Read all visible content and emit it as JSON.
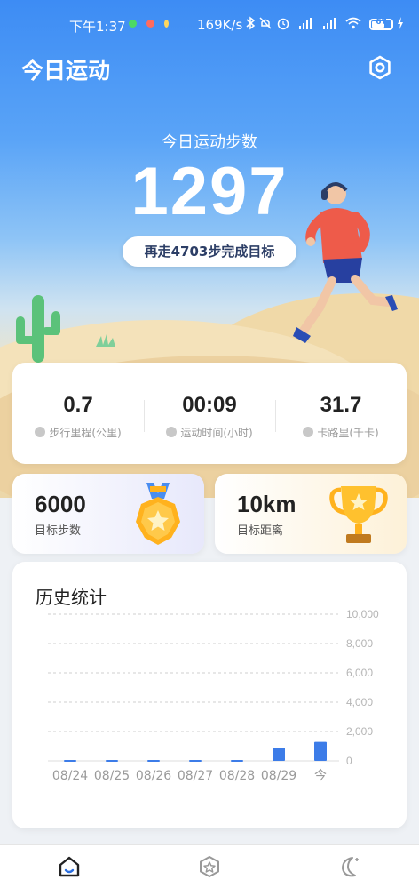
{
  "status_bar": {
    "time": "下午1:37",
    "network_speed": "169K/s",
    "battery": "67",
    "battery_level_percent": 67,
    "icons": [
      "bluetooth-icon",
      "mute-icon",
      "alarm-icon",
      "hd-signal-icon",
      "hd-signal-icon",
      "wifi-icon",
      "charging-icon"
    ]
  },
  "header": {
    "title": "今日运动",
    "settings_icon": "hexagon-settings-icon"
  },
  "today": {
    "label": "今日运动步数",
    "steps": "1297",
    "remaining_text": "再走4703步完成目标"
  },
  "stats": [
    {
      "value": "0.7",
      "label": "步行里程(公里)",
      "icon": "shoe-icon"
    },
    {
      "value": "00:09",
      "label": "运动时间(小时)",
      "icon": "clock-icon"
    },
    {
      "value": "31.7",
      "label": "卡路里(千卡)",
      "icon": "flame-icon"
    }
  ],
  "goals": [
    {
      "value": "6000",
      "label": "目标步数",
      "icon": "medal-icon"
    },
    {
      "value": "10km",
      "label": "目标距离",
      "icon": "trophy-icon"
    }
  ],
  "history": {
    "title": "历史统计"
  },
  "chart_data": {
    "type": "bar",
    "categories": [
      "08/24",
      "08/25",
      "08/26",
      "08/27",
      "08/28",
      "08/29",
      "今"
    ],
    "values": [
      60,
      60,
      60,
      60,
      60,
      900,
      1297
    ],
    "ylim": [
      0,
      10000
    ],
    "yticks": [
      "10,000",
      "8,000",
      "6,000",
      "4,000",
      "2,000",
      "0"
    ],
    "ytick_values": [
      10000,
      8000,
      6000,
      4000,
      2000,
      0
    ],
    "grid": true,
    "bar_color": "#3c7ce8"
  },
  "tabbar": {
    "items": [
      {
        "icon": "home-icon",
        "active": true
      },
      {
        "icon": "badge-star-icon",
        "active": false
      },
      {
        "icon": "moon-sleep-icon",
        "active": false
      }
    ]
  },
  "colors": {
    "accent": "#3d8cf4",
    "active_tab": "#2b6fe0"
  }
}
